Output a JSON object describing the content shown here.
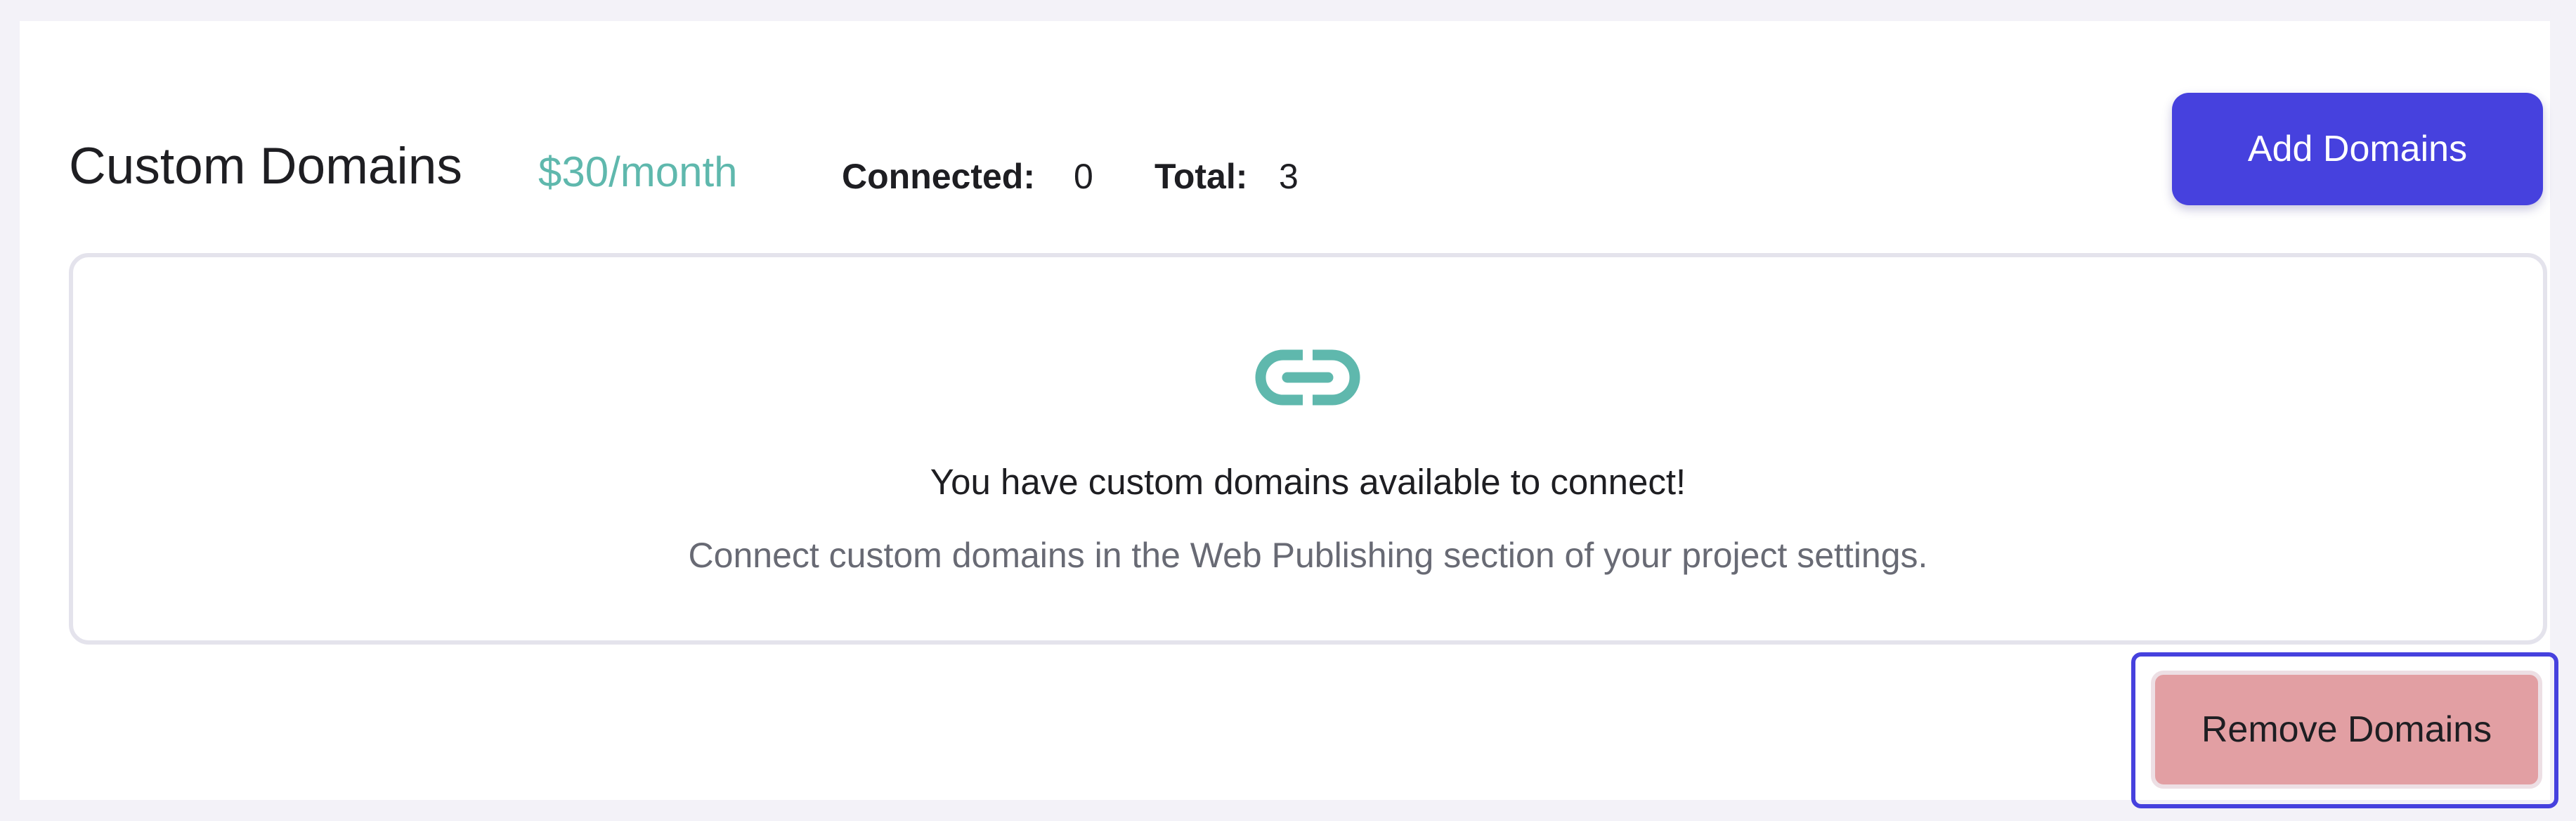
{
  "header": {
    "title": "Custom Domains",
    "price": "$30/month",
    "stats": {
      "connected_label": "Connected:",
      "connected_value": "0",
      "total_label": "Total:",
      "total_value": "3"
    },
    "add_button_label": "Add Domains"
  },
  "empty_state": {
    "icon": "link-icon",
    "headline": "You have custom domains available to connect!",
    "subtext": "Connect custom domains in the Web Publishing section of your project settings."
  },
  "footer": {
    "remove_button_label": "Remove Domains"
  },
  "colors": {
    "accent": "#4641de",
    "teal": "#5fb8ad",
    "danger": "#e29fa3",
    "background": "#f3f2f8"
  }
}
